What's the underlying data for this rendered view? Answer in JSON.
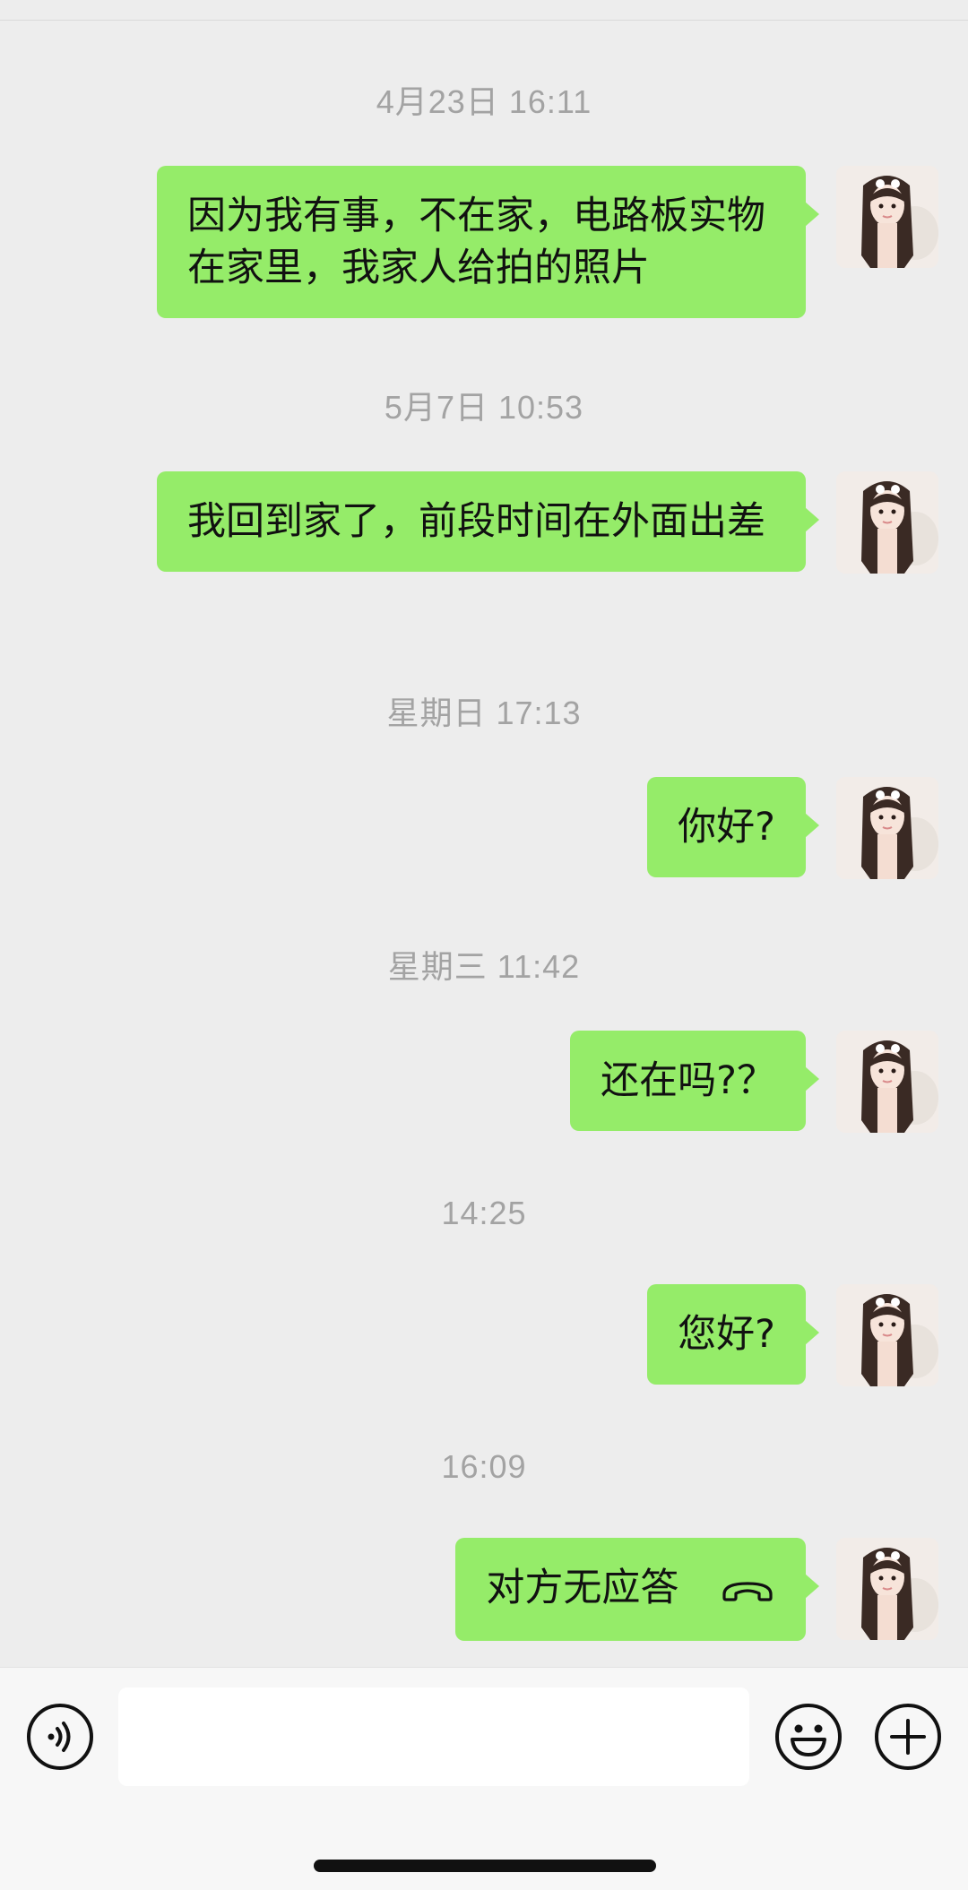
{
  "chat": {
    "messages": [
      {
        "timestamp": "4月23日 16:11",
        "text": "因为我有事，不在家，电路板实物在家里，我家人给拍的照片"
      },
      {
        "timestamp": "5月7日 10:53",
        "text": "我回到家了，前段时间在外面出差"
      },
      {
        "timestamp": "星期日 17:13",
        "text": "你好?"
      },
      {
        "timestamp": "星期三 11:42",
        "text": "还在吗?？"
      },
      {
        "timestamp": "14:25",
        "text": "您好?"
      },
      {
        "timestamp": "16:09",
        "text": "对方无应答",
        "type": "voice-call",
        "icon": "hangup-phone-icon"
      }
    ]
  },
  "input_bar": {
    "voice_icon": "voice-input-icon",
    "emoji_icon": "emoji-icon",
    "plus_icon": "plus-icon",
    "text_value": ""
  },
  "colors": {
    "background": "#ededed",
    "bubble_self": "#95ec69",
    "timestamp_text": "#a3a3a3",
    "input_bar": "#f7f7f7"
  }
}
